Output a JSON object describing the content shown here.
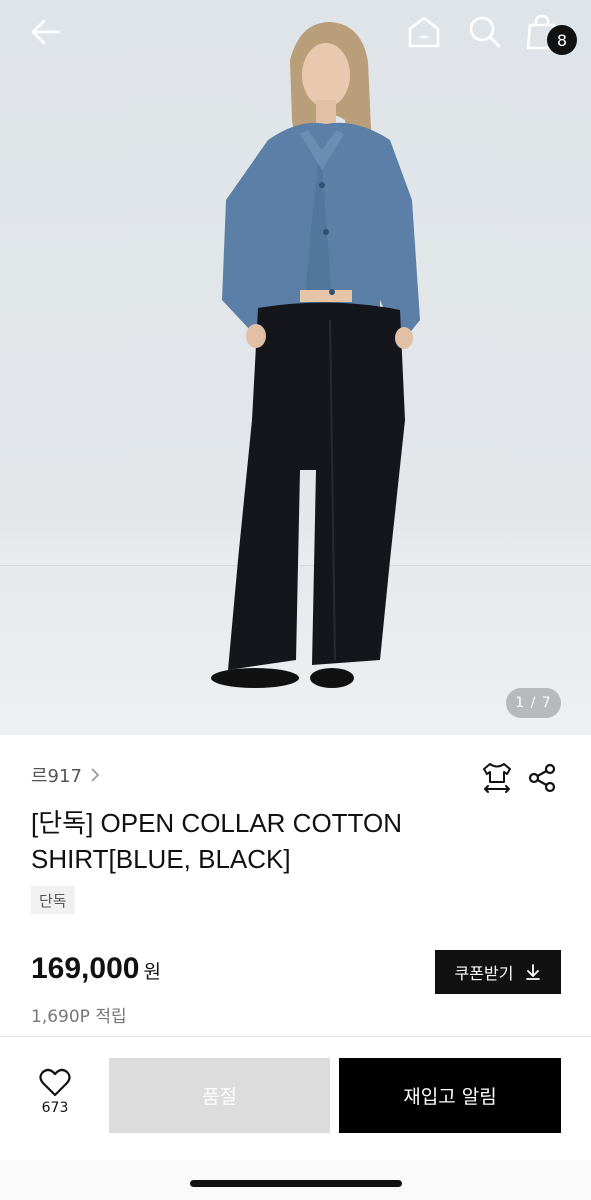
{
  "header": {
    "icons": [
      "back-arrow-icon",
      "home-icon",
      "search-icon",
      "shopping-bag-icon"
    ],
    "cart_count": "8"
  },
  "gallery": {
    "indicator": "1 / 7",
    "image_description_icon": "product-photo"
  },
  "product": {
    "brand": "르917",
    "title": "[단독] OPEN COLLAR COTTON SHIRT[BLUE, BLACK]",
    "tag": "단독",
    "price": "169,000",
    "currency": "원",
    "points": "1,690P 적립"
  },
  "actions": {
    "coupon_label": "쿠폰받기",
    "like_count": "673",
    "soldout_label": "품절",
    "restock_label": "재입고 알림"
  },
  "colors": {
    "accent": "#000000",
    "disabled": "#dcdcdc",
    "shirt_blue": "#5b7fa6"
  }
}
